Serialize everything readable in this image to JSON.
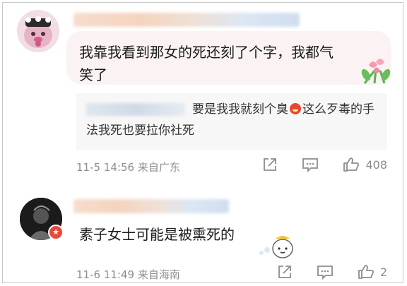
{
  "comments": [
    {
      "text": "我靠我看到那女的死还刻了个字，我都气笑了",
      "reply": {
        "text_before": "要是我我就刻个臭",
        "emoji": "angry-face-emoji",
        "text_after": "这么歹毒的手法我死也要拉你社死"
      },
      "time": "11-5 14:56",
      "location": "来自广东",
      "likes": "408"
    },
    {
      "text": "素子女士可能是被熏死的",
      "time": "11-6 11:49",
      "location": "来自海南",
      "likes": "2"
    }
  ],
  "colors": {
    "bubble": "#fbf3f3",
    "meta": "#8d8d8d",
    "badge": "#e64a3a"
  }
}
